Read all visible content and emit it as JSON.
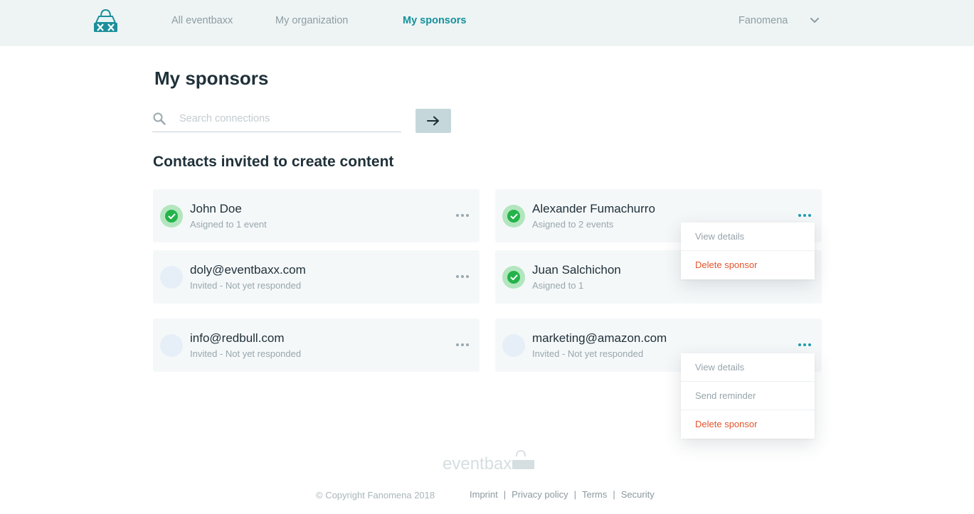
{
  "header": {
    "logo_icon": "eventbaxx-bag-logo-icon",
    "nav": [
      {
        "label": "All eventbaxx"
      },
      {
        "label": "My organization"
      },
      {
        "label": "My sponsors"
      }
    ],
    "active_nav": "My sponsors",
    "user_label": "Fanomena",
    "user_menu_icon": "chevron-down-icon"
  },
  "main": {
    "title": "My sponsors",
    "search": {
      "placeholder": "Search connections",
      "value": "",
      "submit_icon": "arrow-right-icon"
    },
    "section_title": "Contacts invited to create content",
    "contacts": [
      {
        "name": "John Doe",
        "status": "Asigned to 1 event",
        "confirmed": true
      },
      {
        "name": "Alexander Fumachurro",
        "status": "Asigned to 2 events",
        "confirmed": true
      },
      {
        "name": "doly@eventbaxx.com",
        "status": "Invited - Not yet responded",
        "confirmed": false
      },
      {
        "name": "Juan Salchichon",
        "status": "Asigned to 1",
        "confirmed": true
      },
      {
        "name": "info@redbull.com",
        "status": "Invited - Not yet responded",
        "confirmed": false
      },
      {
        "name": "marketing@amazon.com",
        "status": "Invited - Not yet responded",
        "confirmed": false
      }
    ],
    "menus": {
      "confirmed": [
        "View details",
        "Delete sponsor"
      ],
      "invited": [
        "View details",
        "Send reminder",
        "Delete sponsor"
      ]
    }
  },
  "colors": {
    "accent": "#15919c",
    "danger": "#e2542c",
    "success": "#24b34a",
    "header_bg": "#eef4f4",
    "card_bg": "#f5f8f9"
  },
  "footer": {
    "logo_text": "eventbaxx",
    "copyright": "© Copyright Fanomena 2018",
    "links": [
      "Imprint",
      "Privacy policy",
      "Terms",
      "Security"
    ]
  }
}
